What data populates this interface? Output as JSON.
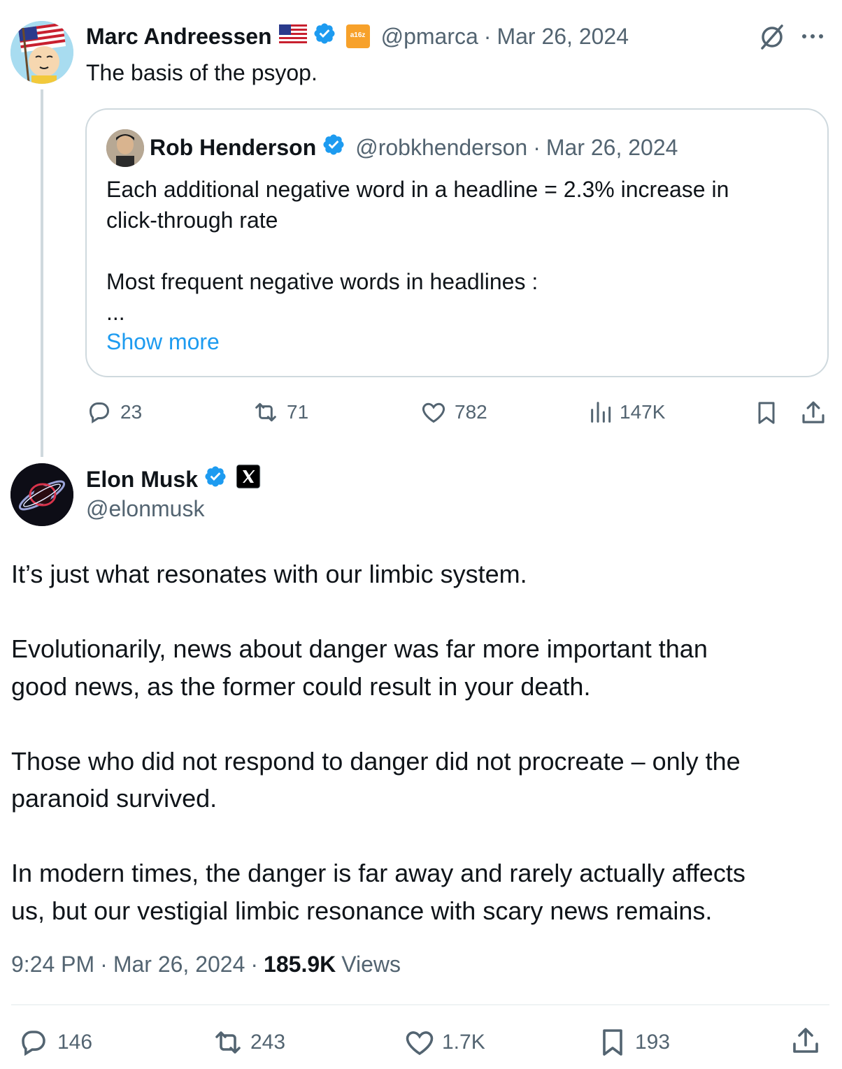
{
  "parent_tweet": {
    "author_name": "Marc Andreessen",
    "handle": "@pmarca",
    "separator": "·",
    "date": "Mar 26, 2024",
    "affiliate_label": "a16z",
    "text": "The basis of the psyop.",
    "quote": {
      "author_name": "Rob Henderson",
      "handle": "@robkhenderson",
      "separator": "·",
      "date": "Mar 26, 2024",
      "text": "Each additional negative word in a headline = 2.3% increase in\nclick-through rate\n\nMost frequent negative words in headlines :\n...",
      "show_more": "Show more"
    },
    "actions": {
      "replies": "23",
      "reposts": "71",
      "likes": "782",
      "views": "147K"
    }
  },
  "main_tweet": {
    "author_name": "Elon Musk",
    "handle": "@elonmusk",
    "text": "It’s just what resonates with our limbic system.\n\nEvolutionarily, news about danger was far more important than\ngood news, as the former could result in your death.\n\nThose who did not respond to danger did not procreate – only the\nparanoid survived.\n\nIn modern times, the danger is far away and rarely actually affects\nus, but our vestigial limbic resonance with scary news remains.",
    "time": "9:24 PM",
    "sep1": "·",
    "date": "Mar 26, 2024",
    "sep2": "·",
    "views_count": "185.9K",
    "views_label": "Views",
    "actions": {
      "replies": "146",
      "reposts": "243",
      "likes": "1.7K",
      "bookmarks": "193"
    }
  },
  "colors": {
    "accent": "#1d9bf0",
    "secondary_text": "#536471",
    "border": "#cfd9de"
  }
}
